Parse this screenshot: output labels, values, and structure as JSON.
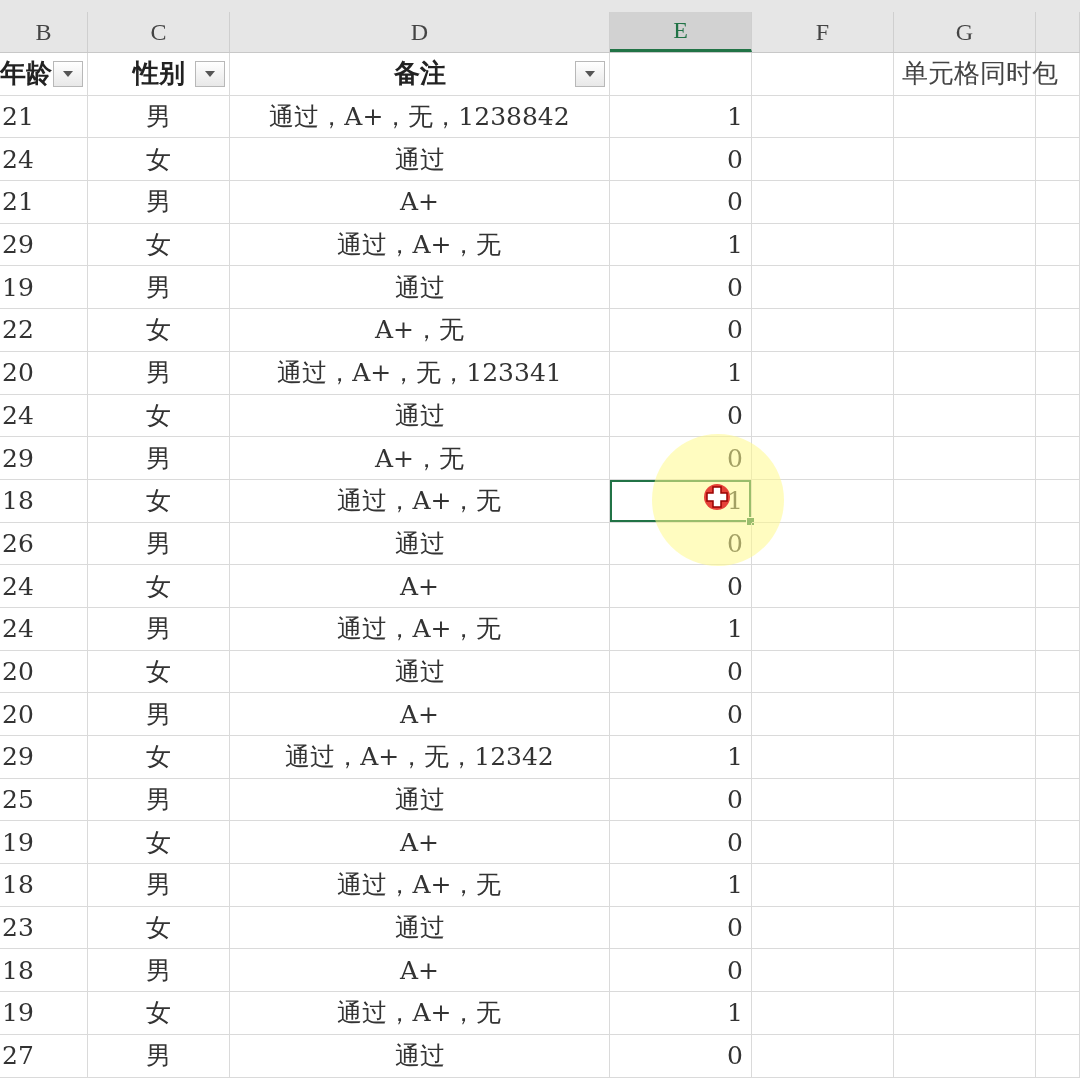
{
  "column_letters": [
    {
      "label": "B",
      "selected": false
    },
    {
      "label": "C",
      "selected": false
    },
    {
      "label": "D",
      "selected": false
    },
    {
      "label": "E",
      "selected": true
    },
    {
      "label": "F",
      "selected": false
    },
    {
      "label": "G",
      "selected": false
    }
  ],
  "header_row": [
    {
      "text": "年龄",
      "filter": true
    },
    {
      "text": "性别",
      "filter": true
    },
    {
      "text": "备注",
      "filter": true
    },
    {
      "filter": false
    },
    {
      "filter": false
    },
    {
      "text": "单元格同时包",
      "filter": false
    }
  ],
  "rows": [
    {
      "age": "21",
      "gender": "男",
      "note": "通过，A+，无，1238842",
      "result": "1",
      "selected": false
    },
    {
      "age": "24",
      "gender": "女",
      "note": "通过",
      "result": "0",
      "selected": false
    },
    {
      "age": "21",
      "gender": "男",
      "note": "A+",
      "result": "0",
      "selected": false
    },
    {
      "age": "29",
      "gender": "女",
      "note": "通过，A+，无",
      "result": "1",
      "selected": false
    },
    {
      "age": "19",
      "gender": "男",
      "note": "通过",
      "result": "0",
      "selected": false
    },
    {
      "age": "22",
      "gender": "女",
      "note": "A+，无",
      "result": "0",
      "selected": false
    },
    {
      "age": "20",
      "gender": "男",
      "note": "通过，A+，无，123341",
      "result": "1",
      "selected": false
    },
    {
      "age": "24",
      "gender": "女",
      "note": "通过",
      "result": "0",
      "selected": false
    },
    {
      "age": "29",
      "gender": "男",
      "note": "A+，无",
      "result": "0",
      "selected": false
    },
    {
      "age": "18",
      "gender": "女",
      "note": "通过，A+，无",
      "result": "1",
      "selected": true
    },
    {
      "age": "26",
      "gender": "男",
      "note": "通过",
      "result": "0",
      "selected": false
    },
    {
      "age": "24",
      "gender": "女",
      "note": "A+",
      "result": "0",
      "selected": false
    },
    {
      "age": "24",
      "gender": "男",
      "note": "通过，A+，无",
      "result": "1",
      "selected": false
    },
    {
      "age": "20",
      "gender": "女",
      "note": "通过",
      "result": "0",
      "selected": false
    },
    {
      "age": "20",
      "gender": "男",
      "note": "A+",
      "result": "0",
      "selected": false
    },
    {
      "age": "29",
      "gender": "女",
      "note": "通过，A+，无，12342",
      "result": "1",
      "selected": false
    },
    {
      "age": "25",
      "gender": "男",
      "note": "通过",
      "result": "0",
      "selected": false
    },
    {
      "age": "19",
      "gender": "女",
      "note": "A+",
      "result": "0",
      "selected": false
    },
    {
      "age": "18",
      "gender": "男",
      "note": "通过，A+，无",
      "result": "1",
      "selected": false
    },
    {
      "age": "23",
      "gender": "女",
      "note": "通过",
      "result": "0",
      "selected": false
    },
    {
      "age": "18",
      "gender": "男",
      "note": "A+",
      "result": "0",
      "selected": false
    },
    {
      "age": "19",
      "gender": "女",
      "note": "通过，A+，无",
      "result": "1",
      "selected": false
    },
    {
      "age": "27",
      "gender": "男",
      "note": "通过",
      "result": "0",
      "selected": false
    }
  ]
}
